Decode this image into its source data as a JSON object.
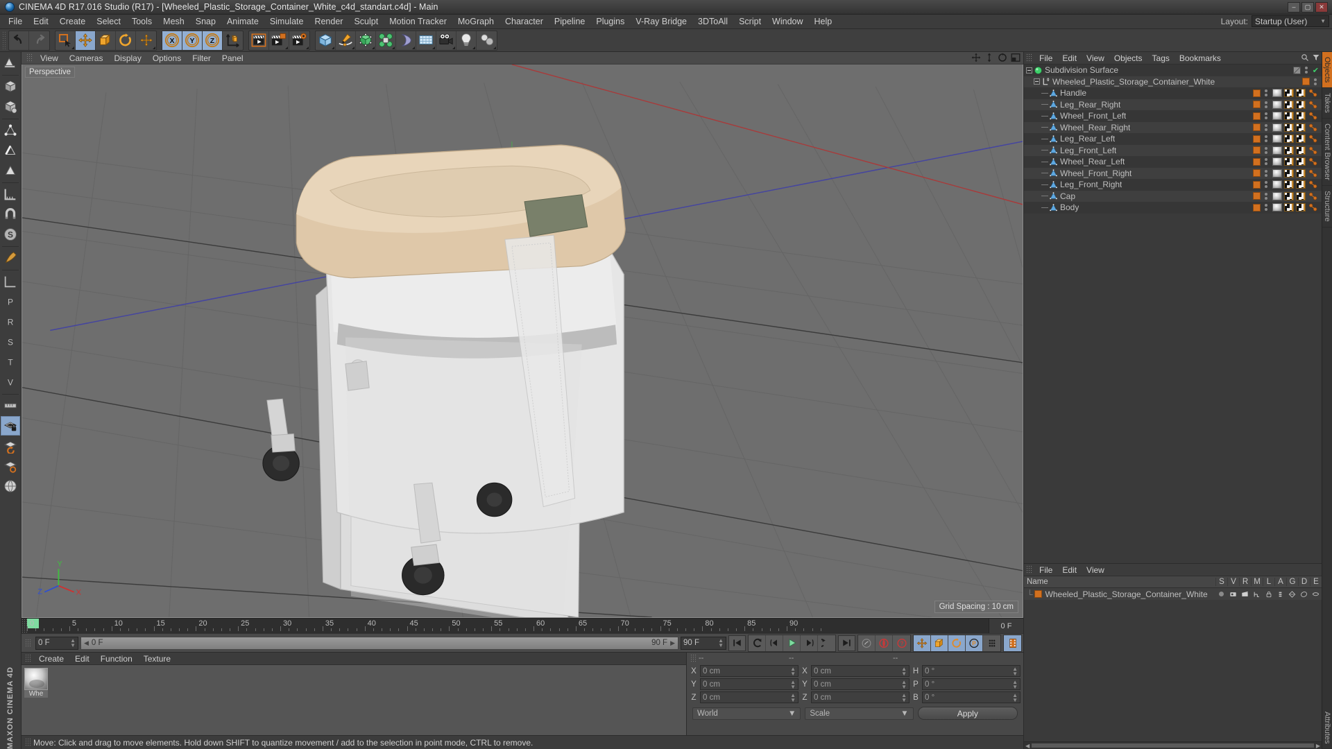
{
  "window": {
    "title": "CINEMA 4D R17.016 Studio (R17) - [Wheeled_Plastic_Storage_Container_White_c4d_standart.c4d] - Main",
    "minimize": "–",
    "maximize": "▢",
    "close": "✕"
  },
  "menubar": {
    "items": [
      "File",
      "Edit",
      "Create",
      "Select",
      "Tools",
      "Mesh",
      "Snap",
      "Animate",
      "Simulate",
      "Render",
      "Sculpt",
      "Motion Tracker",
      "MoGraph",
      "Character",
      "Pipeline",
      "Plugins",
      "V-Ray Bridge",
      "3DToAll",
      "Script",
      "Window",
      "Help"
    ],
    "layout_label": "Layout:",
    "layout_value": "Startup (User)"
  },
  "toolbar": {
    "groups": [
      {
        "name": "history",
        "buttons": [
          {
            "name": "undo-button",
            "icon": "undo"
          },
          {
            "name": "redo-button",
            "icon": "redo"
          }
        ]
      },
      {
        "name": "transform",
        "buttons": [
          {
            "name": "select-tool",
            "icon": "select"
          },
          {
            "name": "move-tool",
            "icon": "move",
            "active": true
          },
          {
            "name": "scale-tool",
            "icon": "scale"
          },
          {
            "name": "rotate-tool",
            "icon": "rotate"
          },
          {
            "name": "move-axis-tool",
            "icon": "move2"
          }
        ]
      },
      {
        "name": "axis-lock",
        "buttons": [
          {
            "name": "lock-x-axis",
            "icon": "X",
            "active": true
          },
          {
            "name": "lock-y-axis",
            "icon": "Y",
            "active": true
          },
          {
            "name": "lock-z-axis",
            "icon": "Z",
            "active": true
          },
          {
            "name": "world-object-coordinates",
            "icon": "axis"
          }
        ]
      },
      {
        "name": "render",
        "buttons": [
          {
            "name": "render-view-button",
            "icon": "clapper"
          },
          {
            "name": "render-region-button",
            "icon": "clapper2"
          },
          {
            "name": "render-to-picture-viewer",
            "icon": "clapper3"
          },
          {
            "name": "render-settings-button",
            "icon": "clapper-gear"
          }
        ]
      },
      {
        "name": "create",
        "buttons": [
          {
            "name": "add-cube-button",
            "icon": "cube"
          },
          {
            "name": "add-spline-button",
            "icon": "pen"
          },
          {
            "name": "add-generator-button",
            "icon": "greencube"
          },
          {
            "name": "add-array-button",
            "icon": "cluster"
          },
          {
            "name": "add-deformer-button",
            "icon": "bend"
          },
          {
            "name": "add-scene-object-button",
            "icon": "floor"
          },
          {
            "name": "add-camera-button",
            "icon": "camera"
          },
          {
            "name": "add-light-button",
            "icon": "bulb"
          },
          {
            "name": "add-mograph-button",
            "icon": "mograph"
          }
        ]
      }
    ]
  },
  "left_toolbar": {
    "buttons": [
      {
        "name": "make-editable-tool",
        "icon": "editable"
      },
      {
        "name": "model-mode-tool",
        "icon": "model"
      },
      {
        "name": "texture-mode-tool",
        "icon": "texture"
      },
      {
        "name": "point-mode-tool",
        "icon": "points"
      },
      {
        "name": "edge-mode-tool",
        "icon": "edges"
      },
      {
        "name": "polygon-mode-tool",
        "icon": "polys"
      },
      {
        "name": "left-ruler-tool",
        "icon": "ruler"
      },
      {
        "name": "magnet-tool",
        "icon": "magnet"
      },
      {
        "name": "snap-tool",
        "icon": "snap-s"
      },
      {
        "name": "workplane-tool",
        "icon": "workplane"
      },
      {
        "name": "brush-tool",
        "icon": "brush"
      },
      {
        "name": "axis-tool",
        "icon": "axis-l"
      },
      {
        "name": "p-tool",
        "icon": "p"
      },
      {
        "name": "r-tool",
        "icon": "r"
      },
      {
        "name": "s-tool",
        "icon": "s"
      },
      {
        "name": "t-tool",
        "icon": "t"
      },
      {
        "name": "v-tool",
        "icon": "v"
      },
      {
        "name": "workplane-lock-tool",
        "icon": "plane-lock",
        "active": true
      },
      {
        "name": "workplane-rotate-tool",
        "icon": "plane-rot"
      },
      {
        "name": "workplane-snap-tool",
        "icon": "plane-snap"
      },
      {
        "name": "world-grid-tool",
        "icon": "grid-globe"
      }
    ],
    "brand_line1": "MAXON",
    "brand_line2": "CINEMA 4D"
  },
  "viewport": {
    "menu": [
      "View",
      "Cameras",
      "Display",
      "Options",
      "Filter",
      "Panel"
    ],
    "label": "Perspective",
    "grid_spacing": "Grid Spacing : 10 cm",
    "axis_labels": {
      "x": "X",
      "y": "Y",
      "z": "Z"
    },
    "nav_icons": [
      "pan-icon",
      "dolly-icon",
      "rotate-icon",
      "maximize-icon"
    ]
  },
  "timeline": {
    "ticks": [
      "0",
      "5",
      "10",
      "15",
      "20",
      "25",
      "30",
      "35",
      "40",
      "45",
      "50",
      "55",
      "60",
      "65",
      "70",
      "75",
      "80",
      "85",
      "90"
    ],
    "end_label": "0 F",
    "current_frame": "0 F",
    "preview_min": "0 F",
    "preview_max": "90 F",
    "document_end": "90 F"
  },
  "transport": {
    "buttons": [
      {
        "name": "go-to-start-button",
        "icon": "skip-start"
      },
      {
        "name": "play-backwards-button",
        "icon": "rew"
      },
      {
        "name": "previous-frame-button",
        "icon": "prev"
      },
      {
        "name": "play-forward-button",
        "icon": "play"
      },
      {
        "name": "next-frame-button",
        "icon": "next"
      },
      {
        "name": "play-loop-button",
        "icon": "loop"
      },
      {
        "name": "go-to-end-button",
        "icon": "skip-end"
      },
      {
        "name": "record-active-objects-button",
        "icon": "key"
      },
      {
        "name": "autokeying-button",
        "icon": "autokey"
      },
      {
        "name": "keyframe-selection-button",
        "icon": "keysel"
      }
    ],
    "toggles": [
      {
        "name": "position-keys-toggle",
        "icon": "pos",
        "active": true
      },
      {
        "name": "scale-keys-toggle",
        "icon": "scale",
        "active": true
      },
      {
        "name": "rotation-keys-toggle",
        "icon": "rot",
        "active": true
      },
      {
        "name": "parameter-keys-toggle",
        "icon": "param",
        "active": true
      },
      {
        "name": "point-level-animation-toggle",
        "icon": "pla",
        "active": false
      },
      {
        "name": "animation-filter-button",
        "icon": "film",
        "active": true
      }
    ]
  },
  "material_manager": {
    "menu": [
      "Create",
      "Edit",
      "Function",
      "Texture"
    ],
    "materials": [
      {
        "name": "Whe",
        "full": "Wheeled_Plastic_Storage_Container_White"
      }
    ]
  },
  "coordinates": {
    "headers": [
      "--",
      "--",
      "--"
    ],
    "rows": [
      {
        "label1": "X",
        "value1": "0 cm",
        "label2": "X",
        "value2": "0 cm",
        "label3": "H",
        "value3": "0 °"
      },
      {
        "label1": "Y",
        "value1": "0 cm",
        "label2": "Y",
        "value2": "0 cm",
        "label3": "P",
        "value3": "0 °"
      },
      {
        "label1": "Z",
        "value1": "0 cm",
        "label2": "Z",
        "value2": "0 cm",
        "label3": "B",
        "value3": "0 °"
      }
    ],
    "space_dropdown": "World",
    "mode_dropdown": "Scale",
    "apply_label": "Apply"
  },
  "statusbar": {
    "text": "Move: Click and drag to move elements. Hold down SHIFT to quantize movement / add to the selection in point mode, CTRL to remove."
  },
  "object_manager": {
    "menu": [
      "File",
      "Edit",
      "View",
      "Objects",
      "Tags",
      "Bookmarks"
    ],
    "items": [
      {
        "name": "Subdivision Surface",
        "depth": 0,
        "icon": "subdivision-surface-icon",
        "tag_color": "grey",
        "has_tags": false,
        "check": true
      },
      {
        "name": "Wheeled_Plastic_Storage_Container_White",
        "depth": 1,
        "icon": "null-object-icon",
        "tag_color": "orange",
        "has_tags": false
      },
      {
        "name": "Handle",
        "depth": 2,
        "icon": "polygon-object-icon",
        "tag_color": "orange",
        "has_tags": true
      },
      {
        "name": "Leg_Rear_Right",
        "depth": 2,
        "icon": "polygon-object-icon",
        "tag_color": "orange",
        "has_tags": true
      },
      {
        "name": "Wheel_Front_Left",
        "depth": 2,
        "icon": "polygon-object-icon",
        "tag_color": "orange",
        "has_tags": true
      },
      {
        "name": "Wheel_Rear_Right",
        "depth": 2,
        "icon": "polygon-object-icon",
        "tag_color": "orange",
        "has_tags": true
      },
      {
        "name": "Leg_Rear_Left",
        "depth": 2,
        "icon": "polygon-object-icon",
        "tag_color": "orange",
        "has_tags": true
      },
      {
        "name": "Leg_Front_Left",
        "depth": 2,
        "icon": "polygon-object-icon",
        "tag_color": "orange",
        "has_tags": true
      },
      {
        "name": "Wheel_Rear_Left",
        "depth": 2,
        "icon": "polygon-object-icon",
        "tag_color": "orange",
        "has_tags": true
      },
      {
        "name": "Wheel_Front_Right",
        "depth": 2,
        "icon": "polygon-object-icon",
        "tag_color": "orange",
        "has_tags": true
      },
      {
        "name": "Leg_Front_Right",
        "depth": 2,
        "icon": "polygon-object-icon",
        "tag_color": "orange",
        "has_tags": true
      },
      {
        "name": "Cap",
        "depth": 2,
        "icon": "polygon-object-icon",
        "tag_color": "orange",
        "has_tags": true
      },
      {
        "name": "Body",
        "depth": 2,
        "icon": "polygon-object-icon",
        "tag_color": "orange",
        "has_tags": true,
        "last": true
      }
    ]
  },
  "layer_manager": {
    "menu": [
      "File",
      "Edit",
      "View"
    ],
    "columns": [
      "Name",
      "S",
      "V",
      "R",
      "M",
      "L",
      "A",
      "G",
      "D",
      "E"
    ],
    "rows": [
      {
        "name": "Wheeled_Plastic_Storage_Container_White",
        "color": "#d2701f"
      }
    ]
  },
  "right_tabs": [
    {
      "label": "Objects",
      "active": true
    },
    {
      "label": "Takes",
      "active": false
    },
    {
      "label": "Content Browser",
      "active": false
    },
    {
      "label": "Structure",
      "active": false
    }
  ],
  "bottom_right_tabs": [
    {
      "label": "Attributes",
      "active": false
    }
  ],
  "colors": {
    "accent_orange": "#d2701f",
    "active_blue": "#8aa7cc",
    "panel_bg": "#3a3a3a",
    "viewport_bg": "#6e6e6e"
  }
}
